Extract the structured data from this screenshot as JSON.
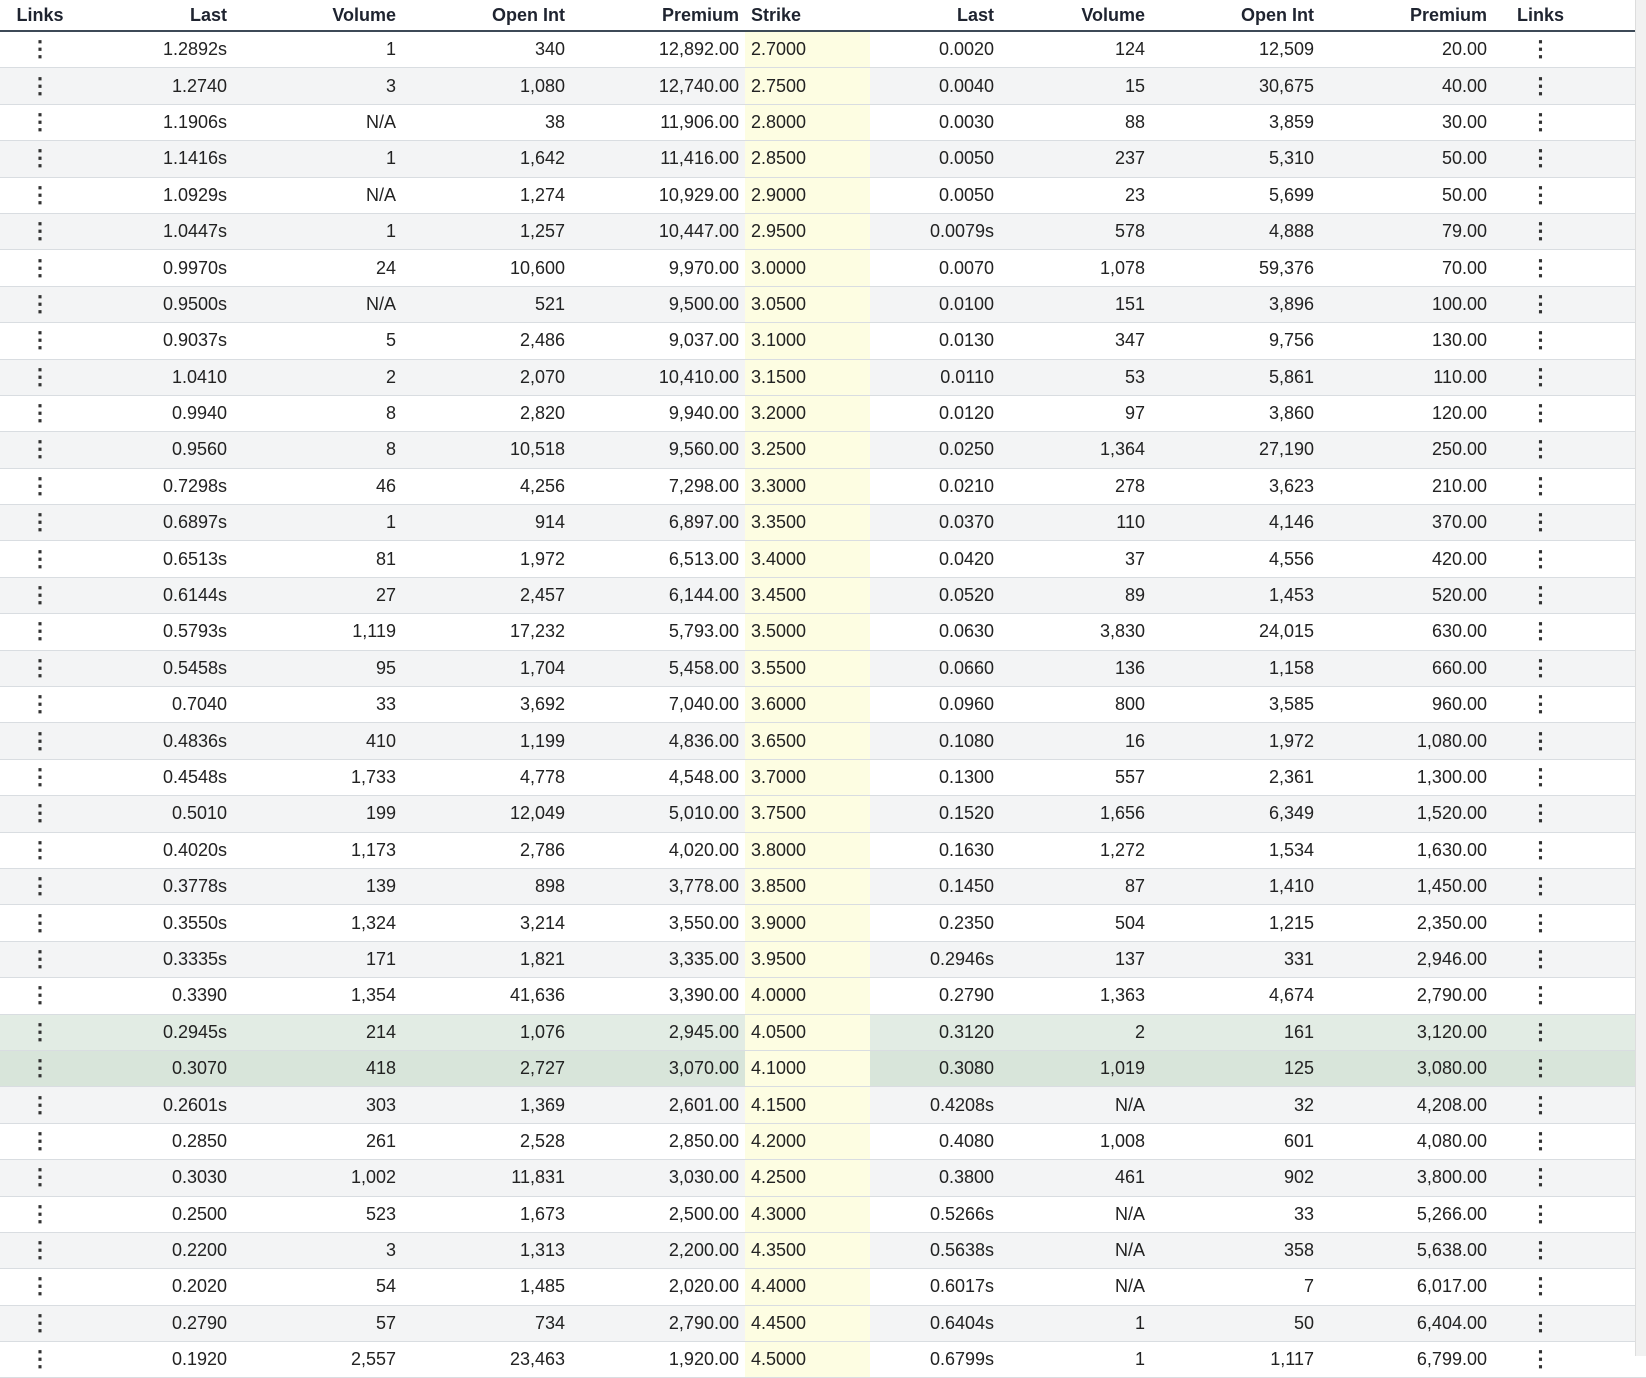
{
  "headers": {
    "calls": {
      "links": "Links",
      "last": "Last",
      "volume": "Volume",
      "open_int": "Open Int",
      "premium": "Premium"
    },
    "strike": "Strike",
    "puts": {
      "last": "Last",
      "volume": "Volume",
      "open_int": "Open Int",
      "premium": "Premium",
      "links": "Links"
    }
  },
  "links_icon": "vertical-ellipsis-icon",
  "colors": {
    "strike_highlight": "#fdfde2",
    "in_the_money": "#e2ece4",
    "header_rule": "#3d4a57"
  },
  "rows": [
    {
      "c_last": "1.2892s",
      "c_vol": "1",
      "c_oi": "340",
      "c_prem": "12,892.00",
      "strike": "2.7000",
      "p_last": "0.0020",
      "p_vol": "124",
      "p_oi": "12,509",
      "p_prem": "20.00"
    },
    {
      "c_last": "1.2740",
      "c_vol": "3",
      "c_oi": "1,080",
      "c_prem": "12,740.00",
      "strike": "2.7500",
      "p_last": "0.0040",
      "p_vol": "15",
      "p_oi": "30,675",
      "p_prem": "40.00"
    },
    {
      "c_last": "1.1906s",
      "c_vol": "N/A",
      "c_oi": "38",
      "c_prem": "11,906.00",
      "strike": "2.8000",
      "p_last": "0.0030",
      "p_vol": "88",
      "p_oi": "3,859",
      "p_prem": "30.00"
    },
    {
      "c_last": "1.1416s",
      "c_vol": "1",
      "c_oi": "1,642",
      "c_prem": "11,416.00",
      "strike": "2.8500",
      "p_last": "0.0050",
      "p_vol": "237",
      "p_oi": "5,310",
      "p_prem": "50.00"
    },
    {
      "c_last": "1.0929s",
      "c_vol": "N/A",
      "c_oi": "1,274",
      "c_prem": "10,929.00",
      "strike": "2.9000",
      "p_last": "0.0050",
      "p_vol": "23",
      "p_oi": "5,699",
      "p_prem": "50.00"
    },
    {
      "c_last": "1.0447s",
      "c_vol": "1",
      "c_oi": "1,257",
      "c_prem": "10,447.00",
      "strike": "2.9500",
      "p_last": "0.0079s",
      "p_vol": "578",
      "p_oi": "4,888",
      "p_prem": "79.00"
    },
    {
      "c_last": "0.9970s",
      "c_vol": "24",
      "c_oi": "10,600",
      "c_prem": "9,970.00",
      "strike": "3.0000",
      "p_last": "0.0070",
      "p_vol": "1,078",
      "p_oi": "59,376",
      "p_prem": "70.00"
    },
    {
      "c_last": "0.9500s",
      "c_vol": "N/A",
      "c_oi": "521",
      "c_prem": "9,500.00",
      "strike": "3.0500",
      "p_last": "0.0100",
      "p_vol": "151",
      "p_oi": "3,896",
      "p_prem": "100.00"
    },
    {
      "c_last": "0.9037s",
      "c_vol": "5",
      "c_oi": "2,486",
      "c_prem": "9,037.00",
      "strike": "3.1000",
      "p_last": "0.0130",
      "p_vol": "347",
      "p_oi": "9,756",
      "p_prem": "130.00"
    },
    {
      "c_last": "1.0410",
      "c_vol": "2",
      "c_oi": "2,070",
      "c_prem": "10,410.00",
      "strike": "3.1500",
      "p_last": "0.0110",
      "p_vol": "53",
      "p_oi": "5,861",
      "p_prem": "110.00"
    },
    {
      "c_last": "0.9940",
      "c_vol": "8",
      "c_oi": "2,820",
      "c_prem": "9,940.00",
      "strike": "3.2000",
      "p_last": "0.0120",
      "p_vol": "97",
      "p_oi": "3,860",
      "p_prem": "120.00"
    },
    {
      "c_last": "0.9560",
      "c_vol": "8",
      "c_oi": "10,518",
      "c_prem": "9,560.00",
      "strike": "3.2500",
      "p_last": "0.0250",
      "p_vol": "1,364",
      "p_oi": "27,190",
      "p_prem": "250.00"
    },
    {
      "c_last": "0.7298s",
      "c_vol": "46",
      "c_oi": "4,256",
      "c_prem": "7,298.00",
      "strike": "3.3000",
      "p_last": "0.0210",
      "p_vol": "278",
      "p_oi": "3,623",
      "p_prem": "210.00"
    },
    {
      "c_last": "0.6897s",
      "c_vol": "1",
      "c_oi": "914",
      "c_prem": "6,897.00",
      "strike": "3.3500",
      "p_last": "0.0370",
      "p_vol": "110",
      "p_oi": "4,146",
      "p_prem": "370.00"
    },
    {
      "c_last": "0.6513s",
      "c_vol": "81",
      "c_oi": "1,972",
      "c_prem": "6,513.00",
      "strike": "3.4000",
      "p_last": "0.0420",
      "p_vol": "37",
      "p_oi": "4,556",
      "p_prem": "420.00"
    },
    {
      "c_last": "0.6144s",
      "c_vol": "27",
      "c_oi": "2,457",
      "c_prem": "6,144.00",
      "strike": "3.4500",
      "p_last": "0.0520",
      "p_vol": "89",
      "p_oi": "1,453",
      "p_prem": "520.00"
    },
    {
      "c_last": "0.5793s",
      "c_vol": "1,119",
      "c_oi": "17,232",
      "c_prem": "5,793.00",
      "strike": "3.5000",
      "p_last": "0.0630",
      "p_vol": "3,830",
      "p_oi": "24,015",
      "p_prem": "630.00"
    },
    {
      "c_last": "0.5458s",
      "c_vol": "95",
      "c_oi": "1,704",
      "c_prem": "5,458.00",
      "strike": "3.5500",
      "p_last": "0.0660",
      "p_vol": "136",
      "p_oi": "1,158",
      "p_prem": "660.00"
    },
    {
      "c_last": "0.7040",
      "c_vol": "33",
      "c_oi": "3,692",
      "c_prem": "7,040.00",
      "strike": "3.6000",
      "p_last": "0.0960",
      "p_vol": "800",
      "p_oi": "3,585",
      "p_prem": "960.00"
    },
    {
      "c_last": "0.4836s",
      "c_vol": "410",
      "c_oi": "1,199",
      "c_prem": "4,836.00",
      "strike": "3.6500",
      "p_last": "0.1080",
      "p_vol": "16",
      "p_oi": "1,972",
      "p_prem": "1,080.00"
    },
    {
      "c_last": "0.4548s",
      "c_vol": "1,733",
      "c_oi": "4,778",
      "c_prem": "4,548.00",
      "strike": "3.7000",
      "p_last": "0.1300",
      "p_vol": "557",
      "p_oi": "2,361",
      "p_prem": "1,300.00"
    },
    {
      "c_last": "0.5010",
      "c_vol": "199",
      "c_oi": "12,049",
      "c_prem": "5,010.00",
      "strike": "3.7500",
      "p_last": "0.1520",
      "p_vol": "1,656",
      "p_oi": "6,349",
      "p_prem": "1,520.00"
    },
    {
      "c_last": "0.4020s",
      "c_vol": "1,173",
      "c_oi": "2,786",
      "c_prem": "4,020.00",
      "strike": "3.8000",
      "p_last": "0.1630",
      "p_vol": "1,272",
      "p_oi": "1,534",
      "p_prem": "1,630.00"
    },
    {
      "c_last": "0.3778s",
      "c_vol": "139",
      "c_oi": "898",
      "c_prem": "3,778.00",
      "strike": "3.8500",
      "p_last": "0.1450",
      "p_vol": "87",
      "p_oi": "1,410",
      "p_prem": "1,450.00"
    },
    {
      "c_last": "0.3550s",
      "c_vol": "1,324",
      "c_oi": "3,214",
      "c_prem": "3,550.00",
      "strike": "3.9000",
      "p_last": "0.2350",
      "p_vol": "504",
      "p_oi": "1,215",
      "p_prem": "2,350.00"
    },
    {
      "c_last": "0.3335s",
      "c_vol": "171",
      "c_oi": "1,821",
      "c_prem": "3,335.00",
      "strike": "3.9500",
      "p_last": "0.2946s",
      "p_vol": "137",
      "p_oi": "331",
      "p_prem": "2,946.00"
    },
    {
      "c_last": "0.3390",
      "c_vol": "1,354",
      "c_oi": "41,636",
      "c_prem": "3,390.00",
      "strike": "4.0000",
      "p_last": "0.2790",
      "p_vol": "1,363",
      "p_oi": "4,674",
      "p_prem": "2,790.00"
    },
    {
      "c_last": "0.2945s",
      "c_vol": "214",
      "c_oi": "1,076",
      "c_prem": "2,945.00",
      "strike": "4.0500",
      "p_last": "0.3120",
      "p_vol": "2",
      "p_oi": "161",
      "p_prem": "3,120.00",
      "band": "itm"
    },
    {
      "c_last": "0.3070",
      "c_vol": "418",
      "c_oi": "2,727",
      "c_prem": "3,070.00",
      "strike": "4.1000",
      "p_last": "0.3080",
      "p_vol": "1,019",
      "p_oi": "125",
      "p_prem": "3,080.00",
      "band": "itm2"
    },
    {
      "c_last": "0.2601s",
      "c_vol": "303",
      "c_oi": "1,369",
      "c_prem": "2,601.00",
      "strike": "4.1500",
      "p_last": "0.4208s",
      "p_vol": "N/A",
      "p_oi": "32",
      "p_prem": "4,208.00"
    },
    {
      "c_last": "0.2850",
      "c_vol": "261",
      "c_oi": "2,528",
      "c_prem": "2,850.00",
      "strike": "4.2000",
      "p_last": "0.4080",
      "p_vol": "1,008",
      "p_oi": "601",
      "p_prem": "4,080.00"
    },
    {
      "c_last": "0.3030",
      "c_vol": "1,002",
      "c_oi": "11,831",
      "c_prem": "3,030.00",
      "strike": "4.2500",
      "p_last": "0.3800",
      "p_vol": "461",
      "p_oi": "902",
      "p_prem": "3,800.00"
    },
    {
      "c_last": "0.2500",
      "c_vol": "523",
      "c_oi": "1,673",
      "c_prem": "2,500.00",
      "strike": "4.3000",
      "p_last": "0.5266s",
      "p_vol": "N/A",
      "p_oi": "33",
      "p_prem": "5,266.00"
    },
    {
      "c_last": "0.2200",
      "c_vol": "3",
      "c_oi": "1,313",
      "c_prem": "2,200.00",
      "strike": "4.3500",
      "p_last": "0.5638s",
      "p_vol": "N/A",
      "p_oi": "358",
      "p_prem": "5,638.00"
    },
    {
      "c_last": "0.2020",
      "c_vol": "54",
      "c_oi": "1,485",
      "c_prem": "2,020.00",
      "strike": "4.4000",
      "p_last": "0.6017s",
      "p_vol": "N/A",
      "p_oi": "7",
      "p_prem": "6,017.00"
    },
    {
      "c_last": "0.2790",
      "c_vol": "57",
      "c_oi": "734",
      "c_prem": "2,790.00",
      "strike": "4.4500",
      "p_last": "0.6404s",
      "p_vol": "1",
      "p_oi": "50",
      "p_prem": "6,404.00"
    },
    {
      "c_last": "0.1920",
      "c_vol": "2,557",
      "c_oi": "23,463",
      "c_prem": "1,920.00",
      "strike": "4.5000",
      "p_last": "0.6799s",
      "p_vol": "1",
      "p_oi": "1,117",
      "p_prem": "6,799.00"
    }
  ]
}
